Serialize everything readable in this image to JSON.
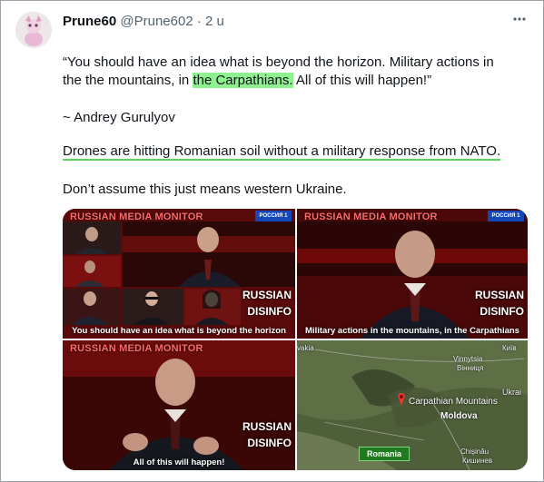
{
  "tweet": {
    "display_name": "Prune60",
    "handle": "@Prune602",
    "separator": "·",
    "time": "2 u",
    "more_icon": "more-horizontal-icon",
    "line1": "“You should have an idea what is beyond the horizon. Military actions in",
    "line2_before": "the the mountains, in ",
    "line2_highlight": "the Carpathians.",
    "line2_after": "  All of this will happen!”",
    "attribution": "~ Andrey Gurulyov",
    "nato_line": "Drones are hitting Romanian soil without a military response from NATO.",
    "closing": "Don’t assume this just means western Ukraine.",
    "highlight_color": "#8ef08e"
  },
  "media": {
    "header": "RUSSIAN MEDIA MONITOR",
    "watermark_line1": "RUSSIAN",
    "watermark_line2": "DISINFO",
    "channel_logo": "РОССИЯ 1",
    "captions": [
      "You should have an idea what is beyond the horizon",
      "Military actions in the mountains, in the Carpathians",
      "All of this will happen!"
    ],
    "map": {
      "edge_left": "vakia",
      "vinnytsia": "Vinnytsia",
      "vinnytsia_local": "Вінниця",
      "kyiv": "Київ",
      "ukraine": "Ukrai",
      "pin_label": "Carpathian Mountains",
      "moldova": "Moldova",
      "chisinau": "Chișinău",
      "chisinau_2": "Кишинев",
      "romania": "Romania"
    }
  }
}
